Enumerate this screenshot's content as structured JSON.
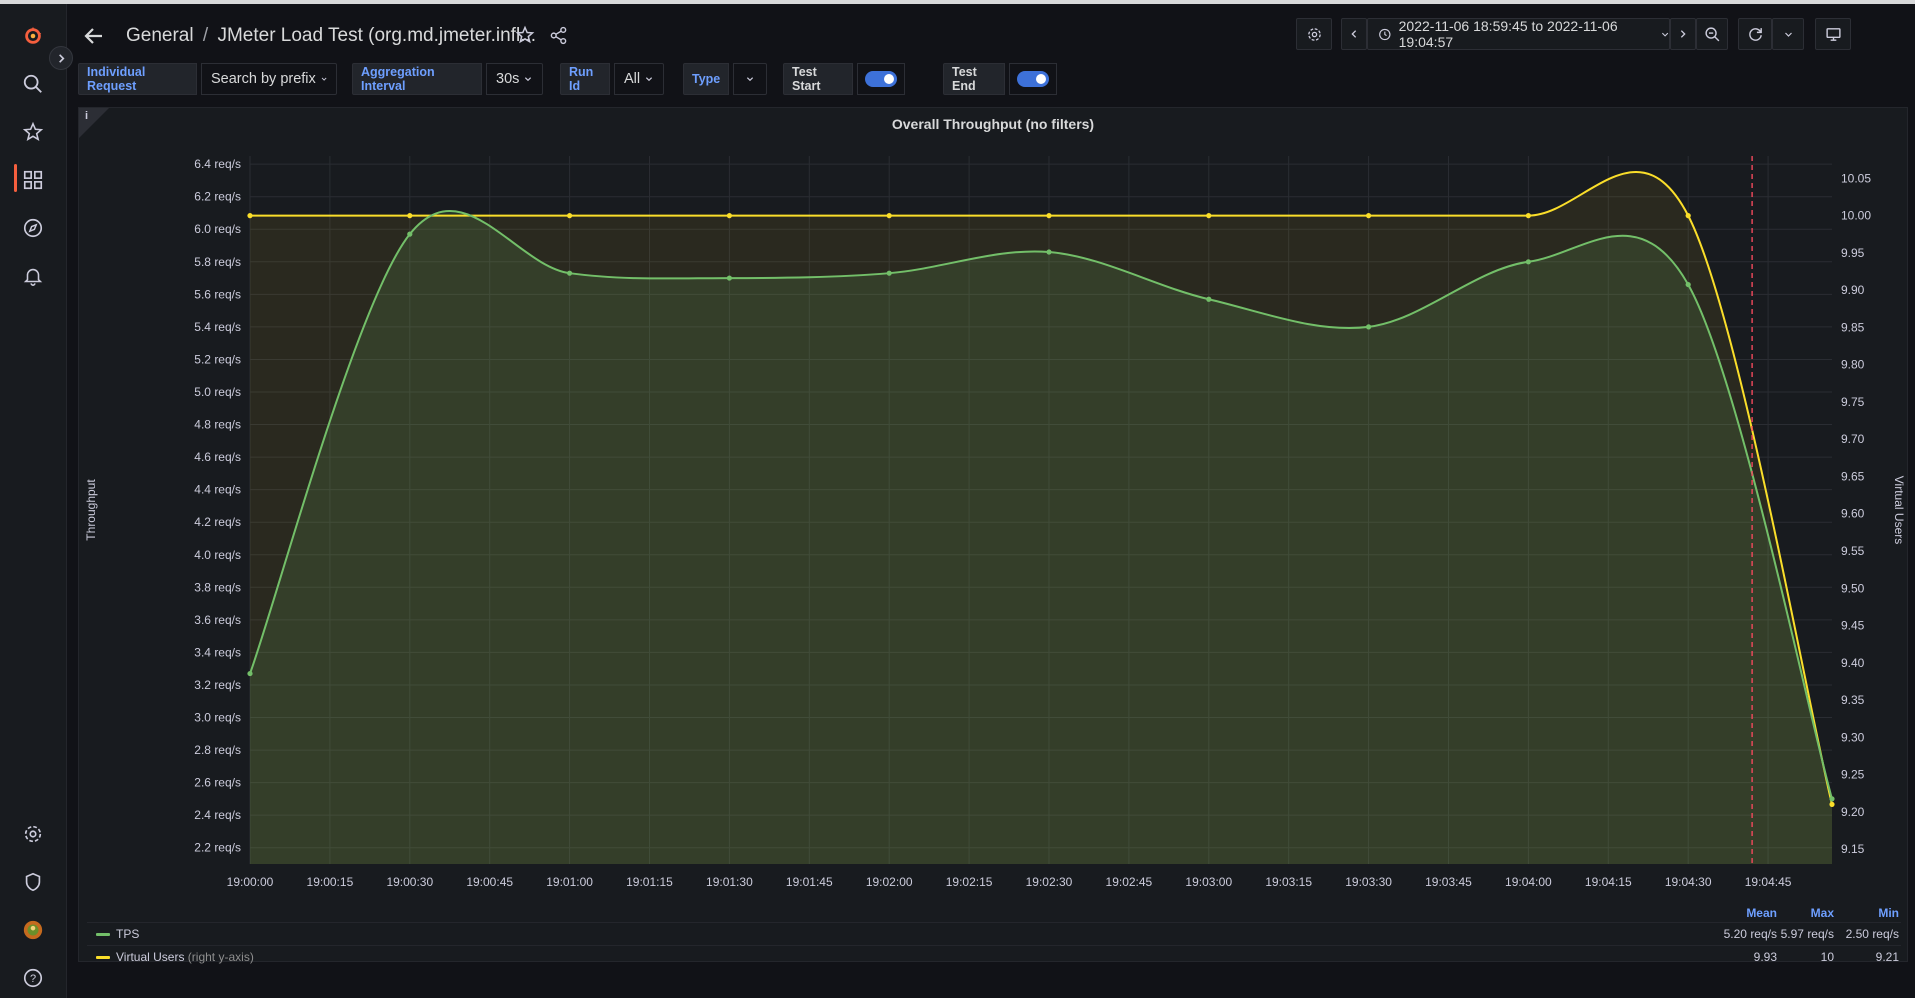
{
  "header": {
    "breadcrumb_root": "General",
    "breadcrumb_sep": "/",
    "dashboard_title": "JMeter Load Test (org.md.jmeter.infl...",
    "time_range": "2022-11-06 18:59:45 to 2022-11-06 19:04:57"
  },
  "variables": {
    "individual_request_label": "Individual Request",
    "individual_request_value": "Search by prefix",
    "aggregation_label": "Aggregation Interval",
    "aggregation_value": "30s",
    "run_id_label": "Run Id",
    "run_id_value": "All",
    "type_label": "Type",
    "test_start_label": "Test Start",
    "test_end_label": "Test End"
  },
  "colors": {
    "tps": "#73bf69",
    "virtual_users": "#fade2a",
    "annotation": "#f2495c",
    "link": "#6e9fff",
    "brand": "#f55f3e"
  },
  "panel": {
    "info": "i",
    "title": "Overall Throughput (no filters)"
  },
  "legend": {
    "headers": [
      "Mean",
      "Max",
      "Min"
    ],
    "items": [
      {
        "name": "TPS",
        "sub": "",
        "mean": "5.20 req/s",
        "max": "5.97 req/s",
        "min": "2.50 req/s"
      },
      {
        "name": "Virtual Users",
        "sub": " (right y-axis)",
        "mean": "9.93",
        "max": "10",
        "min": "9.21"
      }
    ]
  },
  "chart_data": {
    "type": "line",
    "title": "Overall Throughput (no filters)",
    "ylabel": "Throughput",
    "y2label": "Virtual Users",
    "x_ticks": [
      "19:00:00",
      "19:00:15",
      "19:00:30",
      "19:00:45",
      "19:01:00",
      "19:01:15",
      "19:01:30",
      "19:01:45",
      "19:02:00",
      "19:02:15",
      "19:02:30",
      "19:02:45",
      "19:03:00",
      "19:03:15",
      "19:03:30",
      "19:03:45",
      "19:04:00",
      "19:04:15",
      "19:04:30",
      "19:04:45"
    ],
    "x_range_seconds": [
      0,
      297
    ],
    "ylim": [
      2.1,
      6.45
    ],
    "y_ticks": [
      "2.2 req/s",
      "2.4 req/s",
      "2.6 req/s",
      "2.8 req/s",
      "3.0 req/s",
      "3.2 req/s",
      "3.4 req/s",
      "3.6 req/s",
      "3.8 req/s",
      "4.0 req/s",
      "4.2 req/s",
      "4.4 req/s",
      "4.6 req/s",
      "4.8 req/s",
      "5.0 req/s",
      "5.2 req/s",
      "5.4 req/s",
      "5.6 req/s",
      "5.8 req/s",
      "6.0 req/s",
      "6.2 req/s",
      "6.4 req/s"
    ],
    "y2lim": [
      9.13,
      10.08
    ],
    "y2_ticks": [
      "9.15",
      "9.20",
      "9.25",
      "9.30",
      "9.35",
      "9.40",
      "9.45",
      "9.50",
      "9.55",
      "9.60",
      "9.65",
      "9.70",
      "9.75",
      "9.80",
      "9.85",
      "9.90",
      "9.95",
      "10.00",
      "10.05"
    ],
    "series": [
      {
        "name": "TPS",
        "axis": "left",
        "x": [
          "19:00:00",
          "19:00:30",
          "19:01:00",
          "19:01:30",
          "19:02:00",
          "19:02:30",
          "19:03:00",
          "19:03:30",
          "19:04:00",
          "19:04:30",
          "19:04:57"
        ],
        "values": [
          3.27,
          5.97,
          5.73,
          5.7,
          5.73,
          5.86,
          5.57,
          5.4,
          5.8,
          5.66,
          2.5
        ]
      },
      {
        "name": "Virtual Users",
        "axis": "right",
        "x": [
          "19:00:00",
          "19:00:30",
          "19:01:00",
          "19:01:30",
          "19:02:00",
          "19:02:30",
          "19:03:00",
          "19:03:30",
          "19:04:00",
          "19:04:30",
          "19:04:57"
        ],
        "values": [
          10,
          10,
          10,
          10,
          10,
          10,
          10,
          10,
          10,
          10,
          9.21
        ]
      }
    ],
    "annotations": [
      {
        "x": "19:04:42",
        "type": "vertical-dashed"
      }
    ]
  }
}
